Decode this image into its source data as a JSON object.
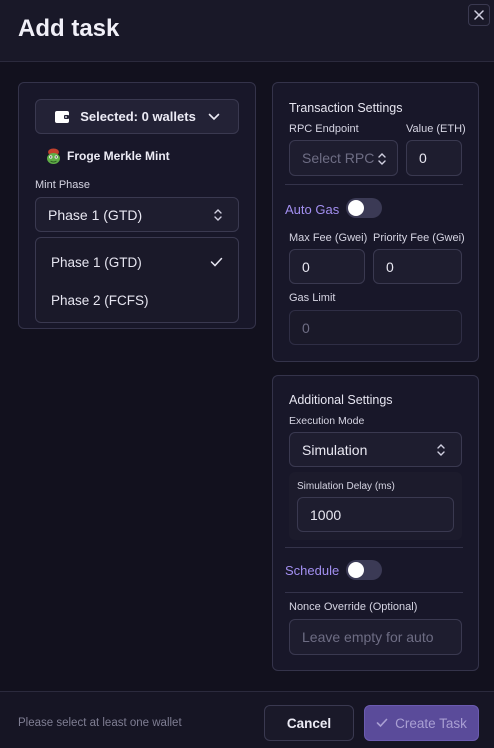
{
  "modal": {
    "title": "Add task"
  },
  "wallets": {
    "selector_label": "Selected: 0 wallets"
  },
  "project": {
    "name": "Froge Merkle Mint"
  },
  "mint_phase": {
    "label": "Mint Phase",
    "selected": "Phase 1 (GTD)",
    "options": [
      "Phase 1 (GTD)",
      "Phase 2 (FCFS)"
    ]
  },
  "transaction": {
    "title": "Transaction Settings",
    "rpc_label": "RPC Endpoint",
    "rpc_placeholder": "Select RPC",
    "value_label": "Value (ETH)",
    "value": "0",
    "auto_gas_label": "Auto Gas",
    "auto_gas_on": false,
    "max_fee_label": "Max Fee (Gwei)",
    "max_fee": "0",
    "priority_fee_label": "Priority Fee (Gwei)",
    "priority_fee": "0",
    "gas_limit_label": "Gas Limit",
    "gas_limit_placeholder": "0"
  },
  "additional": {
    "title": "Additional Settings",
    "mode_label": "Execution Mode",
    "mode": "Simulation",
    "delay_label": "Simulation Delay (ms)",
    "delay": "1000",
    "schedule_label": "Schedule",
    "schedule_on": false,
    "nonce_label": "Nonce Override (Optional)",
    "nonce_placeholder": "Leave empty for auto"
  },
  "footer": {
    "hint": "Please select at least one wallet",
    "cancel_label": "Cancel",
    "create_label": "Create Task"
  },
  "colors": {
    "accent": "#7c68d4",
    "toggle_label": "#a28ff0"
  }
}
